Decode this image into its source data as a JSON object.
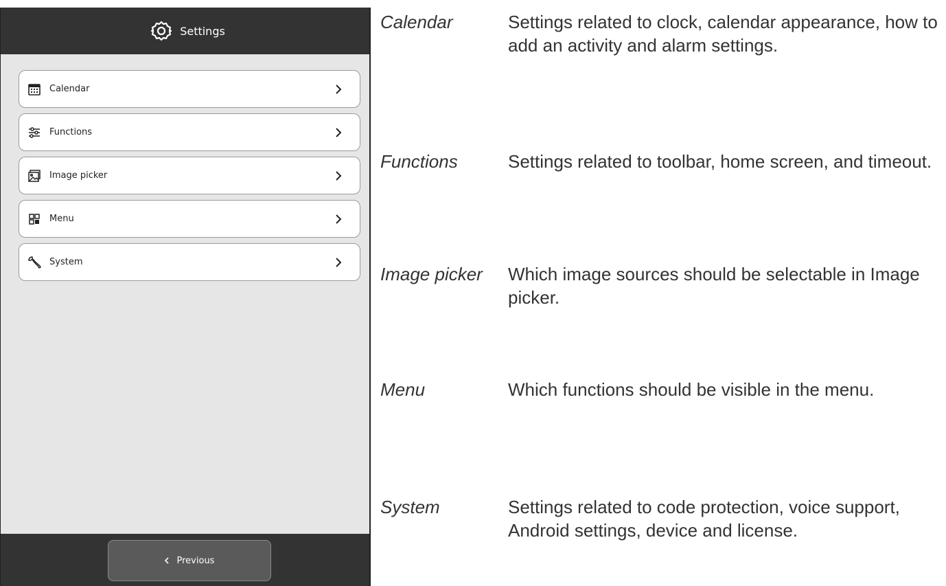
{
  "screen": {
    "header": {
      "title": "Settings",
      "icon": "gear-icon"
    },
    "items": [
      {
        "label": "Calendar",
        "icon": "calendar-icon"
      },
      {
        "label": "Functions",
        "icon": "sliders-icon"
      },
      {
        "label": "Image picker",
        "icon": "image-icon"
      },
      {
        "label": "Menu",
        "icon": "grid-icon"
      },
      {
        "label": "System",
        "icon": "wrench-icon"
      }
    ],
    "footer": {
      "previous_label": "Previous"
    },
    "colors": {
      "bar": "#333333",
      "background": "#e6e6e6",
      "button": "#5a5a5a"
    }
  },
  "descriptions": [
    {
      "term": "Calendar",
      "text": "Settings related to clock, calendar appearance, how to add an activity and alarm settings."
    },
    {
      "term": "Functions",
      "text": "Settings related to toolbar, home screen, and timeout."
    },
    {
      "term": "Image picker",
      "text": "Which image sources should be selectable in Image picker."
    },
    {
      "term": "Menu",
      "text": "Which functions should be visible in the menu."
    },
    {
      "term": "System",
      "text": "Settings related to code protection, voice support, Android settings, device and license."
    }
  ]
}
